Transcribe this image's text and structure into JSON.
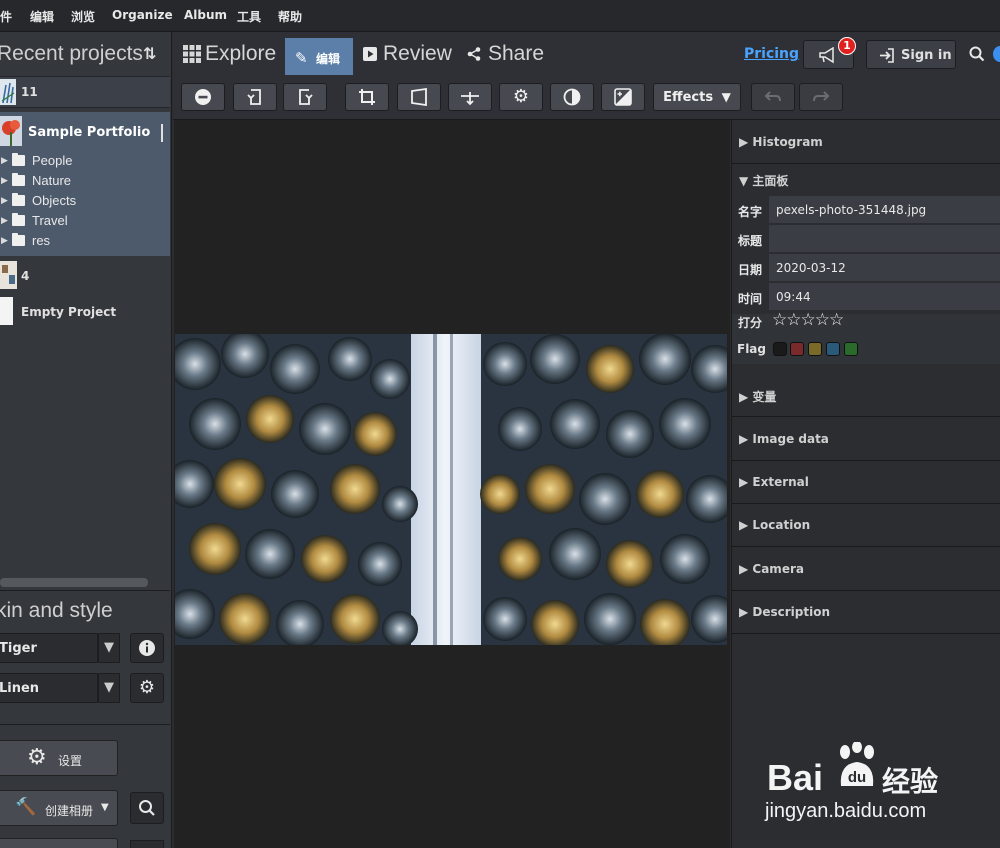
{
  "menu": [
    "件",
    "编辑",
    "浏览",
    "Organize",
    "Album",
    "工具",
    "帮助"
  ],
  "left": {
    "recent_title": "Recent projects",
    "sort_icon": "sort-arrows-icon",
    "projects": [
      {
        "name": "11"
      },
      {
        "name": "Sample Portfolio",
        "folders": [
          "People",
          "Nature",
          "Objects",
          "Travel",
          "res"
        ]
      },
      {
        "name": "4"
      },
      {
        "name": "Empty Project"
      }
    ],
    "skin_title": "kin and style",
    "skin_value": "Tiger",
    "style_value": "Linen",
    "settings_label": "设置",
    "create_album_label": "创建相册"
  },
  "nav": {
    "tabs": [
      "Explore",
      "编辑",
      "Review",
      "Share"
    ],
    "pricing": "Pricing",
    "notification_count": "1",
    "signin": "Sign in"
  },
  "toolbar": {
    "effects": "Effects"
  },
  "right": {
    "histogram": "Histogram",
    "main_panel": "主面板",
    "fields": [
      {
        "key": "名字",
        "value": "pexels-photo-351448.jpg"
      },
      {
        "key": "标题",
        "value": ""
      },
      {
        "key": "日期",
        "value": "2020-03-12"
      },
      {
        "key": "时间",
        "value": "09:44"
      }
    ],
    "rating_label": "打分",
    "rating_stars": "☆☆☆☆☆",
    "flag_label": "Flag",
    "flag_colors": [
      "#1a1a1a",
      "#7a2a2a",
      "#7a6a2a",
      "#2a5a7a",
      "#2a6a2a"
    ],
    "sections": [
      "变量",
      "Image data",
      "External",
      "Location",
      "Camera",
      "Description"
    ]
  },
  "watermark": {
    "brand": "Bai",
    "brand_cn": "经验",
    "url": "jingyan.baidu.com"
  },
  "colors": {
    "accent": "#5b7fa8",
    "selected_project": "#4d5a6c",
    "pricing_link": "#4aa3ff",
    "notify_badge": "#e02020"
  }
}
